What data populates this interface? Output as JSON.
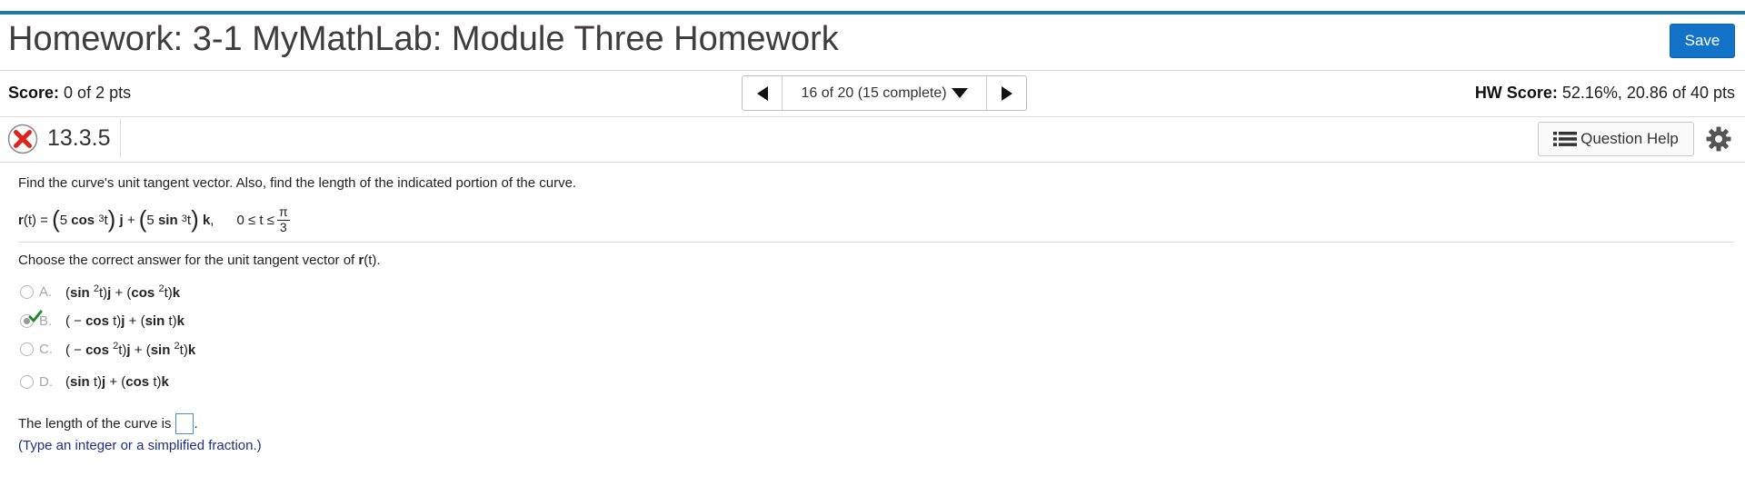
{
  "header": {
    "title": "Homework: 3-1 MyMathLab: Module Three Homework",
    "save_label": "Save",
    "accent_color": "#1f7a9c",
    "save_color": "#1273c9"
  },
  "score_bar": {
    "score_label": "Score:",
    "score_value": "0 of 2 pts",
    "nav_label": "16 of 20 (15 complete)",
    "hw_score_label": "HW Score:",
    "hw_score_value": "52.16%, 20.86 of 40 pts"
  },
  "question": {
    "status_icon": "incorrect-x-icon",
    "number": "13.3.5",
    "help_label": "Question Help",
    "prompt": "Find the curve's unit tangent vector. Also, find the length of the indicated portion of the curve.",
    "formula": {
      "lhs": "r",
      "lhs_arg": "(t) =",
      "term1_coef": "5",
      "term1_fn": "cos",
      "term1_exp": "3",
      "term1_arg": "t",
      "term1_vec": "j",
      "plus": "+",
      "term2_coef": "5",
      "term2_fn": "sin",
      "term2_exp": "3",
      "term2_arg": "t",
      "term2_vec": "k",
      "range_prefix": "0 ≤ t ≤",
      "range_num": "π",
      "range_den": "3"
    },
    "choose_prefix": "Choose the correct answer for the unit tangent vector of ",
    "choose_bold": "r",
    "choose_suffix": "(t).",
    "options": [
      {
        "letter": "A.",
        "selected": false
      },
      {
        "letter": "B.",
        "selected": true
      },
      {
        "letter": "C.",
        "selected": false
      },
      {
        "letter": "D.",
        "selected": false
      }
    ],
    "length_prefix": "The length of the curve is",
    "length_suffix": ".",
    "hint": "(Type an integer or a simplified fraction.)"
  }
}
